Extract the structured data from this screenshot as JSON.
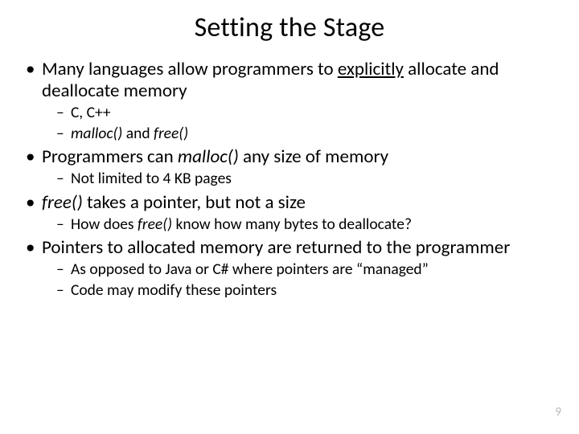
{
  "title": "Setting the Stage",
  "bullets": {
    "b1": {
      "pre": "Many languages allow programmers to ",
      "u": "explicitly",
      "post": " allocate and deallocate memory"
    },
    "b1s1": "C, C++",
    "b1s2_a": "malloc()",
    "b1s2_b": " and ",
    "b1s2_c": "free()",
    "b2_a": "Programmers can ",
    "b2_b": "malloc()",
    "b2_c": " any size of memory",
    "b2s1": "Not limited to 4 KB pages",
    "b3_a": "free()",
    "b3_b": " takes a pointer, but not a size",
    "b3s1_a": "How does ",
    "b3s1_b": "free()",
    "b3s1_c": " know how many bytes to deallocate?",
    "b4": "Pointers to allocated memory are returned to the programmer",
    "b4s1": "As opposed to Java or C# where pointers are “managed”",
    "b4s2": "Code may modify these pointers"
  },
  "page": "9"
}
